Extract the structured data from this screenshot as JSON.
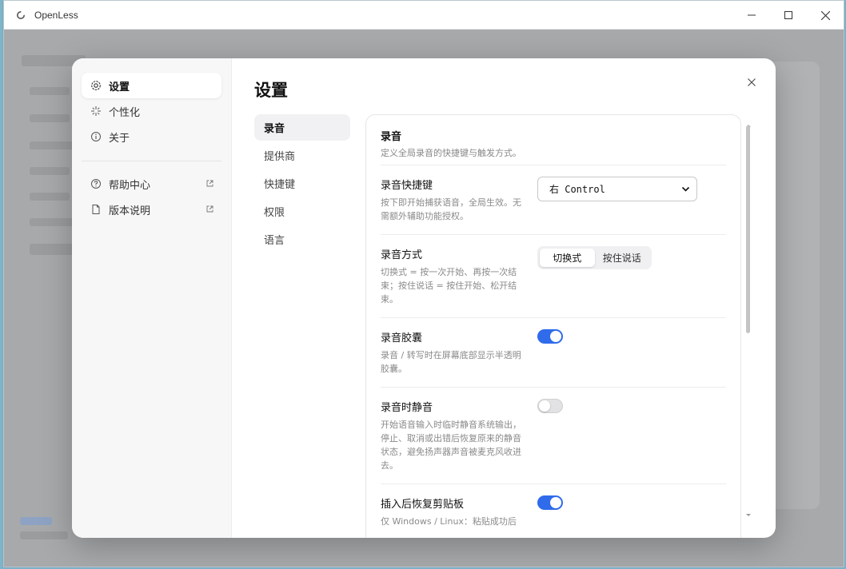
{
  "window": {
    "title": "OpenLess",
    "colors": {
      "accent": "#2f6bea",
      "toggle_off": "#e2e2e4"
    }
  },
  "sidebar": {
    "items": [
      {
        "label": "设置",
        "icon": "gear-icon",
        "active": true
      },
      {
        "label": "个性化",
        "icon": "sparkle-icon"
      },
      {
        "label": "关于",
        "icon": "info-icon"
      }
    ],
    "links": [
      {
        "label": "帮助中心",
        "icon": "help-icon",
        "ext_icon": "external-link-icon"
      },
      {
        "label": "版本说明",
        "icon": "document-icon",
        "ext_icon": "external-link-icon"
      }
    ]
  },
  "modal": {
    "title": "设置",
    "close_icon": "close-icon"
  },
  "subnav": {
    "items": [
      "录音",
      "提供商",
      "快捷键",
      "权限",
      "语言"
    ],
    "active": "录音"
  },
  "section": {
    "title": "录音",
    "desc": "定义全局录音的快捷键与触发方式。"
  },
  "settings": {
    "hotkey": {
      "title": "录音快捷键",
      "desc": "按下即开始捕获语音，全局生效。无需额外辅助功能授权。",
      "value": "右 Control"
    },
    "mode": {
      "title": "录音方式",
      "desc": "切换式 = 按一次开始、再按一次结束；按住说话 = 按住开始、松开结束。",
      "options": [
        "切换式",
        "按住说话"
      ],
      "selected": "切换式"
    },
    "capsule": {
      "title": "录音胶囊",
      "desc": "录音 / 转写时在屏幕底部显示半透明胶囊。",
      "enabled": true
    },
    "mute": {
      "title": "录音时静音",
      "desc": "开始语音输入时临时静音系统输出，停止、取消或出错后恢复原来的静音状态，避免扬声器声音被麦克风收进去。",
      "enabled": false
    },
    "restore_clipboard": {
      "title": "插入后恢复剪贴板",
      "desc": "仅 Windows / Linux：粘贴成功后",
      "enabled": true
    }
  }
}
